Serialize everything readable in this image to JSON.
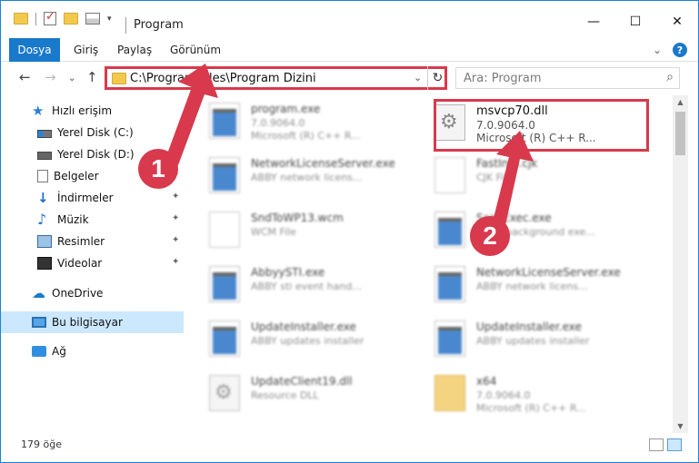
{
  "window": {
    "title": "Program",
    "controls": {
      "minimize": "—",
      "maximize": "☐",
      "close": "✕"
    }
  },
  "ribbon": {
    "tabs": [
      {
        "label": "Dosya",
        "active": true
      },
      {
        "label": "Giriş"
      },
      {
        "label": "Paylaş"
      },
      {
        "label": "Görünüm"
      }
    ],
    "help": "?",
    "collapse": "⌄"
  },
  "nav": {
    "back": "←",
    "forward": "→",
    "dropdown": "⌄",
    "up": "↑",
    "address": "C:\\Program Files\\Program Dizini",
    "address_dropdown": "⌄",
    "refresh": "↻",
    "search_placeholder": "Ara: Program",
    "search_glyph": "⌕"
  },
  "sidebar": {
    "items": [
      {
        "label": "Hızlı erişim",
        "icon": "star-icon"
      },
      {
        "label": "Yerel Disk (C:)",
        "icon": "drive-icon"
      },
      {
        "label": "Yerel Disk (D:)",
        "icon": "drive-icon",
        "pinned": true
      },
      {
        "label": "Belgeler",
        "icon": "documents-icon",
        "pinned": true
      },
      {
        "label": "İndirmeler",
        "icon": "downloads-icon",
        "pinned": true
      },
      {
        "label": "Müzik",
        "icon": "music-icon",
        "pinned": true
      },
      {
        "label": "Resimler",
        "icon": "pictures-icon",
        "pinned": true
      },
      {
        "label": "Videolar",
        "icon": "videos-icon",
        "pinned": true
      },
      {
        "label": "OneDrive",
        "icon": "onedrive-icon"
      },
      {
        "label": "Bu bilgisayar",
        "icon": "this-pc-icon",
        "selected": true
      },
      {
        "label": "Ağ",
        "icon": "network-icon"
      }
    ],
    "pin_glyph": "📌"
  },
  "files": [
    {
      "name": "program.exe",
      "line1": "7.0.9064.0",
      "line2": "Microsoft (R) C++ R...",
      "icon": "exe",
      "blurred": true
    },
    {
      "name": "msvcp70.dll",
      "line1": "7.0.9064.0",
      "line2": "Microsoft (R) C++ R...",
      "icon": "dll",
      "blurred": false,
      "highlighted": true
    },
    {
      "name": "NetworkLicenseServer.exe",
      "line1": "ABBY network licens...",
      "line2": "",
      "icon": "exe",
      "blurred": true
    },
    {
      "name": "FastInfo.cjk",
      "line1": "CJK File",
      "line2": "",
      "icon": "blank",
      "blurred": true
    },
    {
      "name": "SndToWP13.wcm",
      "line1": "WCM File",
      "line2": "",
      "icon": "blank",
      "blurred": true
    },
    {
      "name": "ScanExec.exe",
      "line1": "ABBY background exe...",
      "line2": "",
      "icon": "exe",
      "blurred": true
    },
    {
      "name": "AbbyySTI.exe",
      "line1": "ABBY sti event hand...",
      "line2": "",
      "icon": "exe",
      "blurred": true
    },
    {
      "name": "NetworkLicenseServer.exe",
      "line1": "ABBY network licens...",
      "line2": "",
      "icon": "exe",
      "blurred": true
    },
    {
      "name": "UpdateInstaller.exe",
      "line1": "ABBY updates installer",
      "line2": "",
      "icon": "exe",
      "blurred": true
    },
    {
      "name": "UpdateInstaller.exe",
      "line1": "ABBY updates installer",
      "line2": "",
      "icon": "exe",
      "blurred": true
    },
    {
      "name": "UpdateClient19.dll",
      "line1": "Resource DLL",
      "line2": "",
      "icon": "dll",
      "blurred": true
    },
    {
      "name": "x64",
      "line1": "7.0.9064.0",
      "line2": "Microsoft (R) C++ R...",
      "icon": "folder",
      "blurred": true
    }
  ],
  "scrollbar": {
    "up": "▲",
    "down": "▼"
  },
  "status": {
    "item_count": "179 öğe"
  },
  "annotations": [
    {
      "number": "1"
    },
    {
      "number": "2"
    }
  ],
  "colors": {
    "accent": "#1979ca",
    "annotation": "#d8394c",
    "selection": "#cce8ff"
  }
}
